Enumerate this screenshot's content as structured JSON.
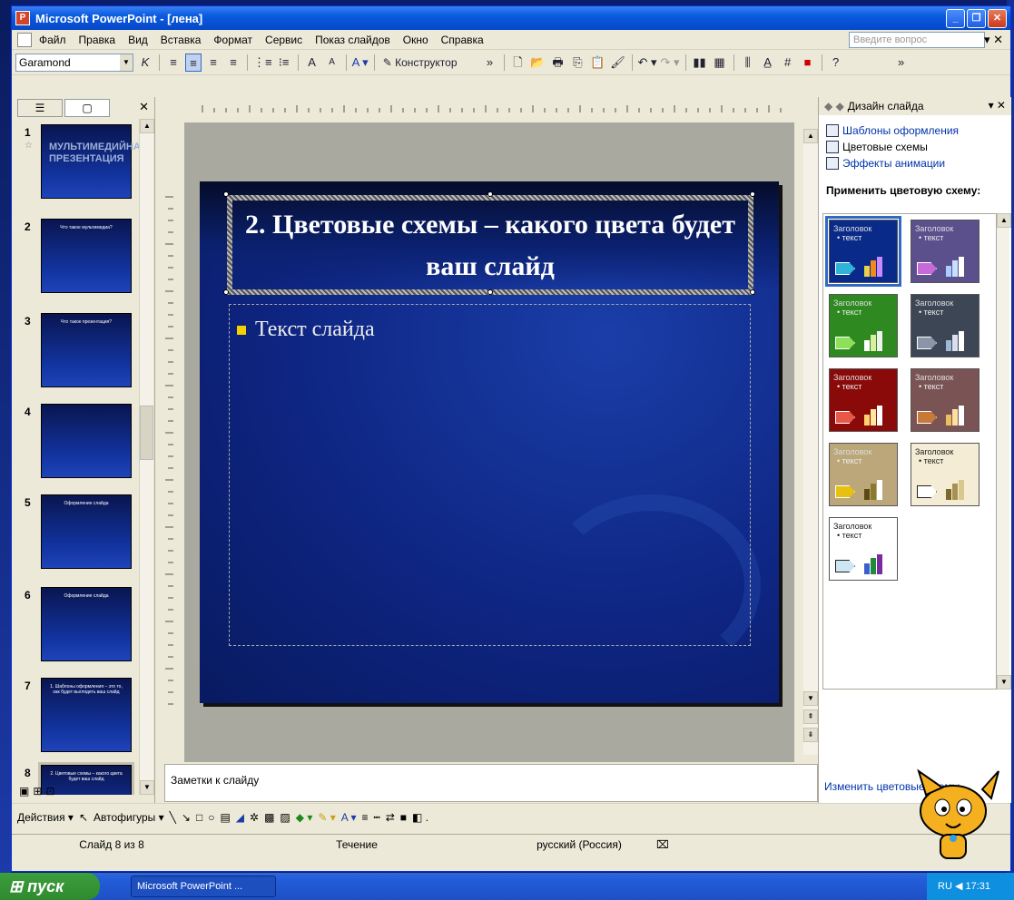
{
  "window": {
    "title": "Microsoft PowerPoint - [лена]",
    "ask_placeholder": "Введите вопрос"
  },
  "menu": [
    "Файл",
    "Правка",
    "Вид",
    "Вставка",
    "Формат",
    "Сервис",
    "Показ слайдов",
    "Окно",
    "Справка"
  ],
  "toolbar": {
    "font": "Garamond",
    "designer_label": "Конструктор"
  },
  "left_pane": {
    "thumbs": [
      {
        "num": "1",
        "text": "МУЛЬТИМЕДИЙНАЯ ПРЕЗЕНТАЦИЯ"
      },
      {
        "num": "2",
        "text": "Что такое мультимедиа?"
      },
      {
        "num": "3",
        "text": "Что такое презентация?"
      },
      {
        "num": "4",
        "text": ""
      },
      {
        "num": "5",
        "text": "Оформление слайда"
      },
      {
        "num": "6",
        "text": "Оформление слайда"
      },
      {
        "num": "7",
        "text": "1. Шаблоны оформления – это то, как будет выглядеть ваш слайд"
      },
      {
        "num": "8",
        "text": "2. Цветовые схемы – какого цвета будет ваш слайд"
      }
    ]
  },
  "slide": {
    "title": "2. Цветовые схемы – какого цвета будет ваш слайд",
    "bullet": "Текст слайда"
  },
  "notes": {
    "placeholder": "Заметки к слайду"
  },
  "task_pane": {
    "title": "Дизайн слайда",
    "links": [
      "Шаблоны оформления",
      "Цветовые схемы",
      "Эффекты анимации"
    ],
    "apply_label": "Применить цветовую схему:",
    "scheme_heading": "Заголовок",
    "scheme_text": "текст",
    "footer_link": "Изменить цветовые схемы",
    "schemes": [
      {
        "bg": "#0a2a8a",
        "arrow": "#2fb3d9",
        "bars": [
          "#e8d24a",
          "#f08a1e",
          "#c98aff"
        ]
      },
      {
        "bg": "#5b4f8c",
        "arrow": "#c56ad8",
        "bars": [
          "#a7d0ff",
          "#c8e0ff",
          "#ffffff"
        ]
      },
      {
        "bg": "#2e8a20",
        "arrow": "#8ee05a",
        "bars": [
          "#ffffff",
          "#d8f0a0",
          "#f0f0f0"
        ]
      },
      {
        "bg": "#3d4654",
        "arrow": "#8a96a8",
        "bars": [
          "#a0b8d8",
          "#d8e0f0",
          "#ffffff"
        ]
      },
      {
        "bg": "#8a0a0a",
        "arrow": "#e85848",
        "bars": [
          "#ffd070",
          "#ffe8a0",
          "#ffffff"
        ]
      },
      {
        "bg": "#7a5454",
        "arrow": "#c87838",
        "bars": [
          "#e8c060",
          "#ffe0a0",
          "#ffffff"
        ]
      },
      {
        "bg": "#bba77a",
        "arrow": "#e8c010",
        "bars": [
          "#5a4a10",
          "#8a7a30",
          "#ffffff"
        ]
      },
      {
        "bg": "#f4ecd4",
        "arrow": "#ffffff",
        "bars": [
          "#7a6a30",
          "#a89050",
          "#d8c890"
        ]
      },
      {
        "bg": "#ffffff",
        "arrow": "#cde6f4",
        "bars": [
          "#3a5fcf",
          "#1e8a3a",
          "#7a2aa0"
        ]
      }
    ]
  },
  "drawbar": {
    "actions": "Действия",
    "autoshapes": "Автофигуры"
  },
  "status": {
    "slide_of": "Слайд 8 из 8",
    "design": "Течение",
    "lang": "русский (Россия)"
  },
  "taskbar": {
    "start": "пуск",
    "item": "Microsoft PowerPoint ...",
    "tray_lang": "RU",
    "clock": "17:31"
  }
}
